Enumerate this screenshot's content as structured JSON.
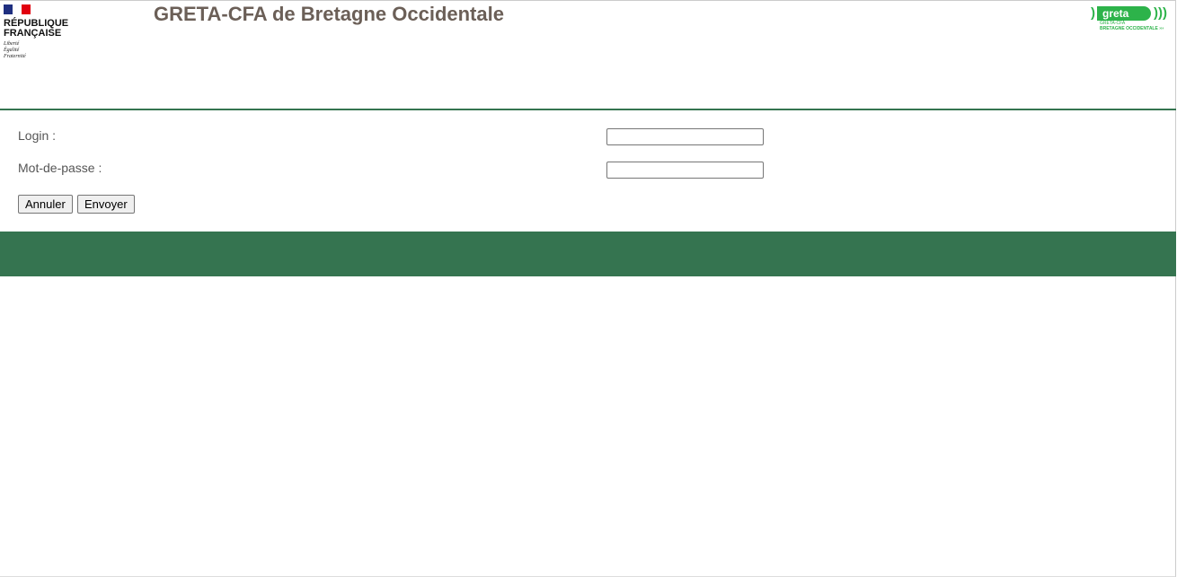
{
  "header": {
    "title": "GRETA-CFA de Bretagne Occidentale",
    "rf_logo": {
      "line1": "RÉPUBLIQUE",
      "line2": "FRANÇAISE",
      "motto": [
        "Liberté",
        "Égalité",
        "Fraternité"
      ]
    },
    "greta_logo": {
      "brand": "greta",
      "line1": "GRETA-CFA",
      "line2": "BRETAGNE OCCIDENTALE ›››"
    }
  },
  "form": {
    "login_label": "Login :",
    "login_value": "",
    "password_label": "Mot-de-passe :",
    "password_value": "",
    "cancel_label": "Annuler",
    "submit_label": "Envoyer"
  },
  "colors": {
    "accent": "#357450",
    "title": "#6b5f57",
    "greta": "#2db34a"
  }
}
